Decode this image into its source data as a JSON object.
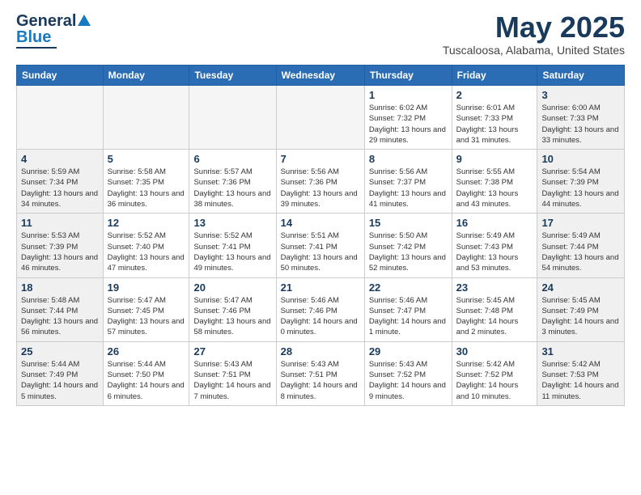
{
  "header": {
    "logo_general": "General",
    "logo_blue": "Blue",
    "month_title": "May 2025",
    "location": "Tuscaloosa, Alabama, United States"
  },
  "weekdays": [
    "Sunday",
    "Monday",
    "Tuesday",
    "Wednesday",
    "Thursday",
    "Friday",
    "Saturday"
  ],
  "weeks": [
    [
      {
        "day": "",
        "sunrise": "",
        "sunset": "",
        "daylight": "",
        "empty": true
      },
      {
        "day": "",
        "sunrise": "",
        "sunset": "",
        "daylight": "",
        "empty": true
      },
      {
        "day": "",
        "sunrise": "",
        "sunset": "",
        "daylight": "",
        "empty": true
      },
      {
        "day": "",
        "sunrise": "",
        "sunset": "",
        "daylight": "",
        "empty": true
      },
      {
        "day": "1",
        "sunrise": "Sunrise: 6:02 AM",
        "sunset": "Sunset: 7:32 PM",
        "daylight": "Daylight: 13 hours and 29 minutes.",
        "empty": false
      },
      {
        "day": "2",
        "sunrise": "Sunrise: 6:01 AM",
        "sunset": "Sunset: 7:33 PM",
        "daylight": "Daylight: 13 hours and 31 minutes.",
        "empty": false
      },
      {
        "day": "3",
        "sunrise": "Sunrise: 6:00 AM",
        "sunset": "Sunset: 7:33 PM",
        "daylight": "Daylight: 13 hours and 33 minutes.",
        "empty": false
      }
    ],
    [
      {
        "day": "4",
        "sunrise": "Sunrise: 5:59 AM",
        "sunset": "Sunset: 7:34 PM",
        "daylight": "Daylight: 13 hours and 34 minutes.",
        "empty": false
      },
      {
        "day": "5",
        "sunrise": "Sunrise: 5:58 AM",
        "sunset": "Sunset: 7:35 PM",
        "daylight": "Daylight: 13 hours and 36 minutes.",
        "empty": false
      },
      {
        "day": "6",
        "sunrise": "Sunrise: 5:57 AM",
        "sunset": "Sunset: 7:36 PM",
        "daylight": "Daylight: 13 hours and 38 minutes.",
        "empty": false
      },
      {
        "day": "7",
        "sunrise": "Sunrise: 5:56 AM",
        "sunset": "Sunset: 7:36 PM",
        "daylight": "Daylight: 13 hours and 39 minutes.",
        "empty": false
      },
      {
        "day": "8",
        "sunrise": "Sunrise: 5:56 AM",
        "sunset": "Sunset: 7:37 PM",
        "daylight": "Daylight: 13 hours and 41 minutes.",
        "empty": false
      },
      {
        "day": "9",
        "sunrise": "Sunrise: 5:55 AM",
        "sunset": "Sunset: 7:38 PM",
        "daylight": "Daylight: 13 hours and 43 minutes.",
        "empty": false
      },
      {
        "day": "10",
        "sunrise": "Sunrise: 5:54 AM",
        "sunset": "Sunset: 7:39 PM",
        "daylight": "Daylight: 13 hours and 44 minutes.",
        "empty": false
      }
    ],
    [
      {
        "day": "11",
        "sunrise": "Sunrise: 5:53 AM",
        "sunset": "Sunset: 7:39 PM",
        "daylight": "Daylight: 13 hours and 46 minutes.",
        "empty": false
      },
      {
        "day": "12",
        "sunrise": "Sunrise: 5:52 AM",
        "sunset": "Sunset: 7:40 PM",
        "daylight": "Daylight: 13 hours and 47 minutes.",
        "empty": false
      },
      {
        "day": "13",
        "sunrise": "Sunrise: 5:52 AM",
        "sunset": "Sunset: 7:41 PM",
        "daylight": "Daylight: 13 hours and 49 minutes.",
        "empty": false
      },
      {
        "day": "14",
        "sunrise": "Sunrise: 5:51 AM",
        "sunset": "Sunset: 7:41 PM",
        "daylight": "Daylight: 13 hours and 50 minutes.",
        "empty": false
      },
      {
        "day": "15",
        "sunrise": "Sunrise: 5:50 AM",
        "sunset": "Sunset: 7:42 PM",
        "daylight": "Daylight: 13 hours and 52 minutes.",
        "empty": false
      },
      {
        "day": "16",
        "sunrise": "Sunrise: 5:49 AM",
        "sunset": "Sunset: 7:43 PM",
        "daylight": "Daylight: 13 hours and 53 minutes.",
        "empty": false
      },
      {
        "day": "17",
        "sunrise": "Sunrise: 5:49 AM",
        "sunset": "Sunset: 7:44 PM",
        "daylight": "Daylight: 13 hours and 54 minutes.",
        "empty": false
      }
    ],
    [
      {
        "day": "18",
        "sunrise": "Sunrise: 5:48 AM",
        "sunset": "Sunset: 7:44 PM",
        "daylight": "Daylight: 13 hours and 56 minutes.",
        "empty": false
      },
      {
        "day": "19",
        "sunrise": "Sunrise: 5:47 AM",
        "sunset": "Sunset: 7:45 PM",
        "daylight": "Daylight: 13 hours and 57 minutes.",
        "empty": false
      },
      {
        "day": "20",
        "sunrise": "Sunrise: 5:47 AM",
        "sunset": "Sunset: 7:46 PM",
        "daylight": "Daylight: 13 hours and 58 minutes.",
        "empty": false
      },
      {
        "day": "21",
        "sunrise": "Sunrise: 5:46 AM",
        "sunset": "Sunset: 7:46 PM",
        "daylight": "Daylight: 14 hours and 0 minutes.",
        "empty": false
      },
      {
        "day": "22",
        "sunrise": "Sunrise: 5:46 AM",
        "sunset": "Sunset: 7:47 PM",
        "daylight": "Daylight: 14 hours and 1 minute.",
        "empty": false
      },
      {
        "day": "23",
        "sunrise": "Sunrise: 5:45 AM",
        "sunset": "Sunset: 7:48 PM",
        "daylight": "Daylight: 14 hours and 2 minutes.",
        "empty": false
      },
      {
        "day": "24",
        "sunrise": "Sunrise: 5:45 AM",
        "sunset": "Sunset: 7:49 PM",
        "daylight": "Daylight: 14 hours and 3 minutes.",
        "empty": false
      }
    ],
    [
      {
        "day": "25",
        "sunrise": "Sunrise: 5:44 AM",
        "sunset": "Sunset: 7:49 PM",
        "daylight": "Daylight: 14 hours and 5 minutes.",
        "empty": false
      },
      {
        "day": "26",
        "sunrise": "Sunrise: 5:44 AM",
        "sunset": "Sunset: 7:50 PM",
        "daylight": "Daylight: 14 hours and 6 minutes.",
        "empty": false
      },
      {
        "day": "27",
        "sunrise": "Sunrise: 5:43 AM",
        "sunset": "Sunset: 7:51 PM",
        "daylight": "Daylight: 14 hours and 7 minutes.",
        "empty": false
      },
      {
        "day": "28",
        "sunrise": "Sunrise: 5:43 AM",
        "sunset": "Sunset: 7:51 PM",
        "daylight": "Daylight: 14 hours and 8 minutes.",
        "empty": false
      },
      {
        "day": "29",
        "sunrise": "Sunrise: 5:43 AM",
        "sunset": "Sunset: 7:52 PM",
        "daylight": "Daylight: 14 hours and 9 minutes.",
        "empty": false
      },
      {
        "day": "30",
        "sunrise": "Sunrise: 5:42 AM",
        "sunset": "Sunset: 7:52 PM",
        "daylight": "Daylight: 14 hours and 10 minutes.",
        "empty": false
      },
      {
        "day": "31",
        "sunrise": "Sunrise: 5:42 AM",
        "sunset": "Sunset: 7:53 PM",
        "daylight": "Daylight: 14 hours and 11 minutes.",
        "empty": false
      }
    ]
  ]
}
